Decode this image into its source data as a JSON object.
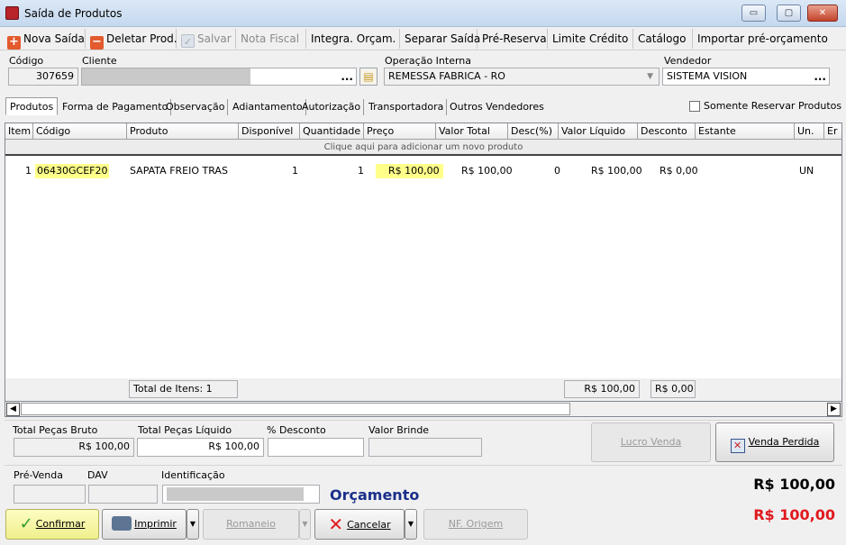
{
  "window": {
    "title": "Saída de Produtos",
    "btn_min": "▭",
    "btn_max": "▢",
    "btn_close": "✕"
  },
  "toolbar": {
    "nova_saida": "Nova Saída",
    "deletar": "Deletar Prod.",
    "salvar": "Salvar",
    "nota_fiscal": "Nota Fiscal",
    "integra": "Integra. Orçam.",
    "separar": "Separar Saída",
    "pre_reserva": "Pré-Reserva",
    "limite": "Limite Crédito",
    "catalogo": "Catálogo",
    "importar": "Importar pré-orçamento"
  },
  "form": {
    "codigo_label": "Código",
    "codigo_value": "307659",
    "cliente_label": "Cliente",
    "cliente_value": "",
    "dots": "...",
    "operacao_label": "Operação Interna",
    "operacao_value": "REMESSA FABRICA - RO",
    "vendedor_label": "Vendedor",
    "vendedor_value": "SISTEMA VISION"
  },
  "tabs": [
    "Produtos",
    "Forma de Pagamento",
    "Observação",
    "Adiantamento",
    "Autorização",
    "Transportadora",
    "Outros Vendedores"
  ],
  "somente_reservar": "Somente Reservar Produtos",
  "grid": {
    "columns": [
      "Item",
      "Código",
      "Produto",
      "Disponível",
      "Quantidade",
      "Preço",
      "Valor Total",
      "Desc(%)",
      "Valor Líquido",
      "Desconto",
      "Estante",
      "Un.",
      "Er"
    ],
    "add_row": "Clique aqui para adicionar um novo produto",
    "rows": [
      {
        "item": "1",
        "codigo": "06430GCEF20",
        "produto": "SAPATA FREIO TRAS",
        "disponivel": "1",
        "quantidade": "1",
        "preco": "R$ 100,00",
        "valor_total": "R$ 100,00",
        "desc": "0",
        "valor_liquido": "R$ 100,00",
        "desconto": "R$ 0,00",
        "estante": "",
        "un": "UN"
      }
    ],
    "total_itens": "Total de Itens: 1",
    "total_liquido": "R$ 100,00",
    "total_desconto": "R$ 0,00"
  },
  "summary": {
    "bruto_label": "Total Peças Bruto",
    "bruto_value": "R$ 100,00",
    "liquido_label": "Total Peças Líquido",
    "liquido_value": "R$ 100,00",
    "desconto_label": "% Desconto",
    "desconto_value": "",
    "brinde_label": "Valor Brinde",
    "brinde_value": "",
    "lucro_venda": "Lucro Venda",
    "venda_perdida": "Venda Perdida"
  },
  "bottom": {
    "pre_venda_label": "Pré-Venda",
    "dav_label": "DAV",
    "identificacao_label": "Identificação",
    "orcamento": "Orçamento",
    "total_black": "R$ 100,00",
    "total_red": "R$ 100,00",
    "confirmar": "Confirmar",
    "imprimir": "Imprimir",
    "romaneio": "Romaneio",
    "cancelar": "Cancelar",
    "nf_origem": "NF. Origem"
  }
}
